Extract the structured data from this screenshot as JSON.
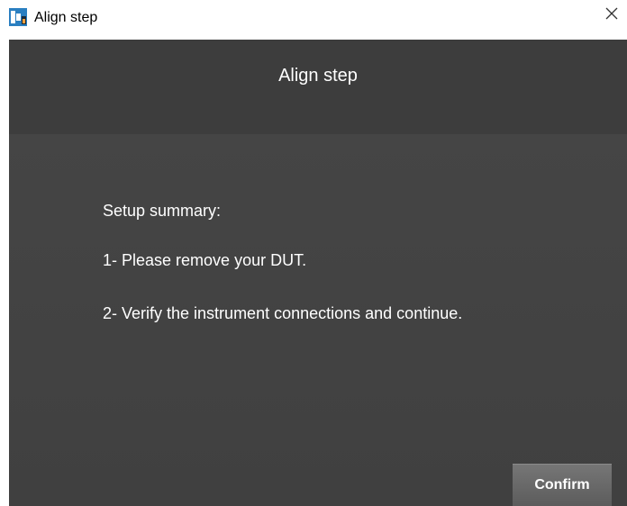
{
  "window": {
    "title": "Align step",
    "icon": "app-icon",
    "close_icon": "close-icon"
  },
  "dialog": {
    "header_title": "Align step",
    "summary": [
      "Setup summary:",
      "1- Please remove your DUT.",
      "2- Verify the instrument connections and continue."
    ],
    "confirm_label": "Confirm"
  },
  "colors": {
    "content_background": "#434343",
    "header_background": "#3d3d3d",
    "button_background": "#6a6a6a",
    "text": "#ffffff"
  }
}
